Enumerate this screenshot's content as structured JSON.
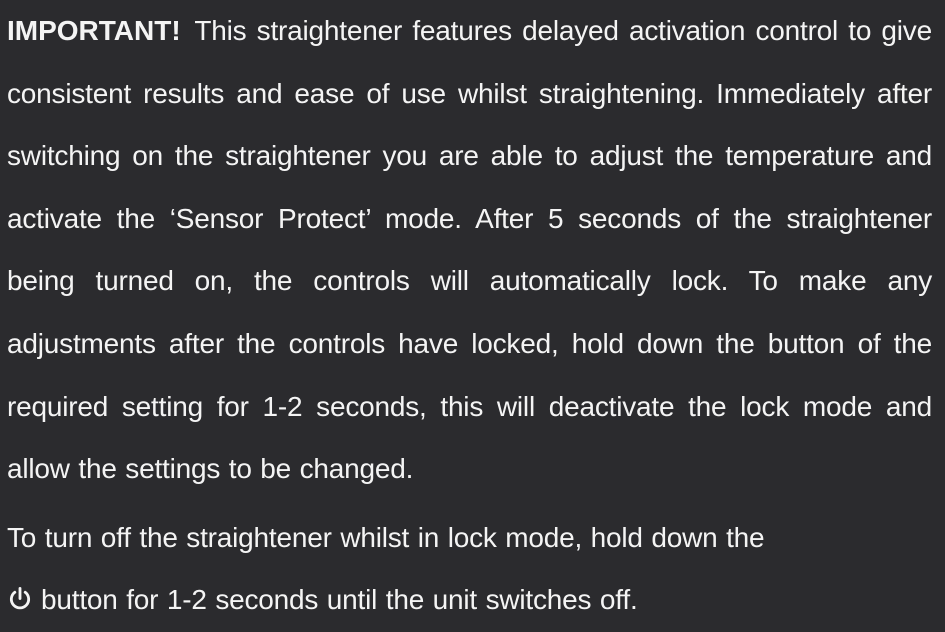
{
  "notice": {
    "important_label": "IMPORTANT!",
    "paragraph1_text": "This straightener features delayed activation control to give consistent results and ease of use whilst straightening. Immediately after switching on the straightener you are able to adjust the temperature and activate the ‘Sensor Protect’ mode. After 5 seconds of the straightener being turned on, the controls will automatically lock.  To make any adjustments after the controls have locked, hold down the button of the required setting for 1-2 seconds, this will deactivate the lock mode and allow the settings to be changed.",
    "paragraph2_text_before_icon": "To turn off the straightener whilst in lock mode, hold down the",
    "paragraph2_text_after_icon": "button for 1-2 seconds until the unit switches off.",
    "power_icon_name": "power-icon"
  }
}
